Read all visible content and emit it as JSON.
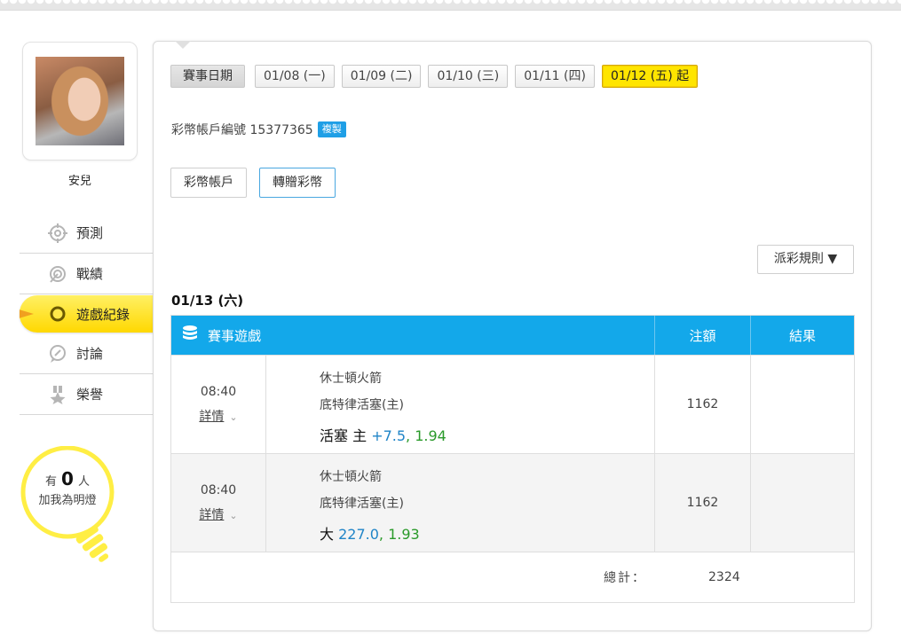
{
  "user": {
    "name": "安兒"
  },
  "nav": {
    "items": [
      {
        "label": "預測",
        "icon": "crosshair-icon"
      },
      {
        "label": "戰績",
        "icon": "target-icon"
      },
      {
        "label": "遊戲紀錄",
        "icon": "ring-icon",
        "active": true
      },
      {
        "label": "討論",
        "icon": "chat-icon"
      },
      {
        "label": "榮譽",
        "icon": "medal-icon"
      }
    ]
  },
  "bulb": {
    "prefix": "有",
    "count": "0",
    "suffix": "人",
    "line2": "加我為明燈"
  },
  "dates": {
    "label": "賽事日期",
    "items": [
      {
        "label": "01/08 (一)"
      },
      {
        "label": "01/09 (二)"
      },
      {
        "label": "01/10 (三)"
      },
      {
        "label": "01/11 (四)"
      },
      {
        "label": "01/12 (五) 起",
        "active": true
      }
    ]
  },
  "account": {
    "label": "彩幣帳戶編號 15377365",
    "copy_label": "複製"
  },
  "buttons": {
    "wallet": "彩幣帳戶",
    "transfer": "轉贈彩幣"
  },
  "rules": {
    "label": "派彩規則 ▼"
  },
  "day": {
    "title": "01/13 (六)"
  },
  "table": {
    "headers": {
      "game": "賽事遊戲",
      "amount": "注額",
      "result": "結果"
    },
    "rows": [
      {
        "time": "08:40",
        "detail": "詳情",
        "away": "休士頓火箭",
        "home": "底特律活塞(主)",
        "bet_pick": "活塞 主",
        "bet_line": "+7.5",
        "bet_sep": ",",
        "bet_odds": "1.94",
        "amount": "1162",
        "result": ""
      },
      {
        "time": "08:40",
        "detail": "詳情",
        "away": "休士頓火箭",
        "home": "底特律活塞(主)",
        "bet_pick": "大",
        "bet_line": "227.0",
        "bet_sep": ",",
        "bet_odds": "1.93",
        "amount": "1162",
        "result": ""
      }
    ],
    "total_label": "總計：",
    "total_value": "2324"
  },
  "colors": {
    "accent_blue": "#13a8ea",
    "active_yellow": "#ffe500",
    "line_blue": "#1f84c7",
    "odds_green": "#2a9a2a"
  }
}
